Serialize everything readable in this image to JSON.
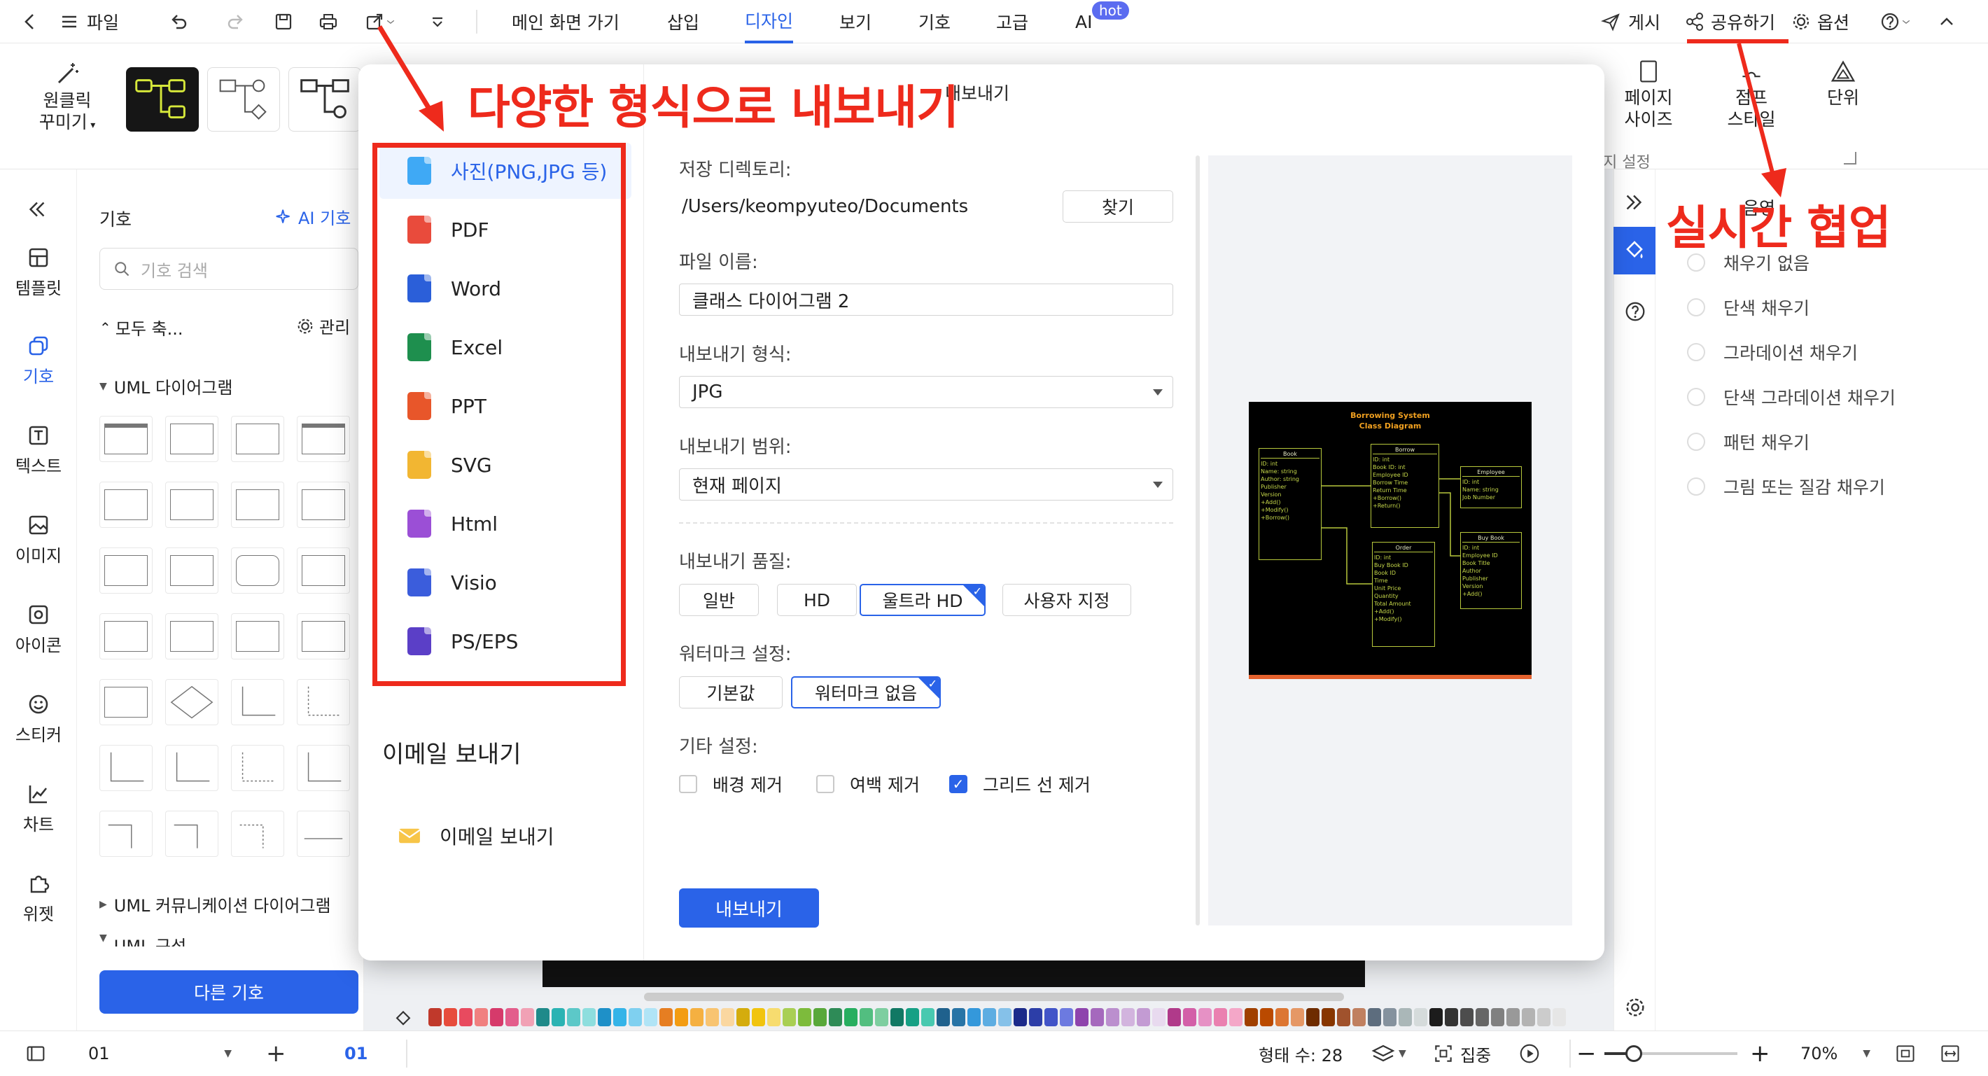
{
  "topbar": {
    "file": "파일",
    "tabs": [
      "메인 화면 가기",
      "삽입",
      "디자인",
      "보기",
      "기호",
      "고급",
      "AI"
    ],
    "hot_badge": "hot",
    "publish": "게시",
    "share": "공유하기",
    "options": "옵션"
  },
  "ribbon": {
    "oneclick": "원클릭 꾸미기",
    "oneclick_l1": "원클릭",
    "oneclick_l2": "꾸미기",
    "page_size_l1": "페이지",
    "page_size_l2": "사이즈",
    "jump_l1": "점프",
    "jump_l2": "스타일",
    "unit": "단위",
    "page_settings": "지 설정"
  },
  "leftbar": [
    {
      "label": "템플릿",
      "icon": "template-icon"
    },
    {
      "label": "기호",
      "icon": "symbols-icon"
    },
    {
      "label": "텍스트",
      "icon": "text-icon"
    },
    {
      "label": "이미지",
      "icon": "image-icon"
    },
    {
      "label": "아이콘",
      "icon": "icon-icon"
    },
    {
      "label": "스티커",
      "icon": "sticker-icon"
    },
    {
      "label": "차트",
      "icon": "chart-icon"
    },
    {
      "label": "위젯",
      "icon": "widget-icon"
    }
  ],
  "symbols": {
    "title": "기호",
    "ai_symbols": "AI 기호",
    "search_placeholder": "기호 검색",
    "collapse_all": "모두 축...",
    "manage": "관리",
    "section_uml": "UML 다이어그램",
    "section_uml_comm": "UML 커뮤니케이션 다이어그램",
    "section_uml_comp": "UML 구성",
    "more_button": "다른 기호"
  },
  "rightpanel": {
    "tab": "음영",
    "fill_options": [
      "채우기 없음",
      "단색 채우기",
      "그라데이션 채우기",
      "단색 그라데이션 채우기",
      "패턴 채우기",
      "그림 또는 질감 채우기"
    ]
  },
  "dialog": {
    "title": "내보내기",
    "formats": [
      {
        "label": "사진(PNG,JPG 등)",
        "color": "#3fa9f5"
      },
      {
        "label": "PDF",
        "color": "#e94b3c"
      },
      {
        "label": "Word",
        "color": "#2b5fd9"
      },
      {
        "label": "Excel",
        "color": "#1e8f4e"
      },
      {
        "label": "PPT",
        "color": "#e8562a"
      },
      {
        "label": "SVG",
        "color": "#f2b632"
      },
      {
        "label": "Html",
        "color": "#9b4fd6"
      },
      {
        "label": "Visio",
        "color": "#3b5ddc"
      },
      {
        "label": "PS/EPS",
        "color": "#5b3fc7"
      }
    ],
    "email_heading": "이메일 보내기",
    "email_item": "이메일 보내기",
    "save_dir_label": "저장 디렉토리:",
    "save_dir_value": "/Users/keompyuteo/Documents",
    "browse": "찾기",
    "filename_label": "파일 이름:",
    "filename_value": "클래스 다이어그램 2",
    "format_label": "내보내기 형식:",
    "format_value": "JPG",
    "range_label": "내보내기 범위:",
    "range_value": "현재 페이지",
    "quality_label": "내보내기 품질:",
    "quality_options": [
      "일반",
      "HD",
      "울트라 HD",
      "사용자 지정"
    ],
    "watermark_label": "워터마크 설정:",
    "watermark_options": [
      "기본값",
      "워터마크 없음"
    ],
    "other_label": "기타 설정:",
    "other_options": [
      "배경 제거",
      "여백 제거",
      "그리드 선 제거"
    ],
    "export_button": "내보내기",
    "check_mark": "✓"
  },
  "preview": {
    "title1": "Borrowing System",
    "title2": "Class Diagram",
    "box_book": "Book",
    "box_borrow": "Borrow",
    "box_employee": "Employee",
    "box_order": "Order",
    "box_buybook": "Buy Book"
  },
  "statusbar": {
    "page": "01",
    "page_tab": "01",
    "shape_count": "형태 수: 28",
    "focus": "집중",
    "zoom": "70%"
  },
  "annotations": {
    "export_formats": "다양한 형식으로 내보내기",
    "realtime_collab": "실시간 협업"
  },
  "colors": {
    "accent": "#2a63e8",
    "annotation": "#ee2a1c"
  }
}
